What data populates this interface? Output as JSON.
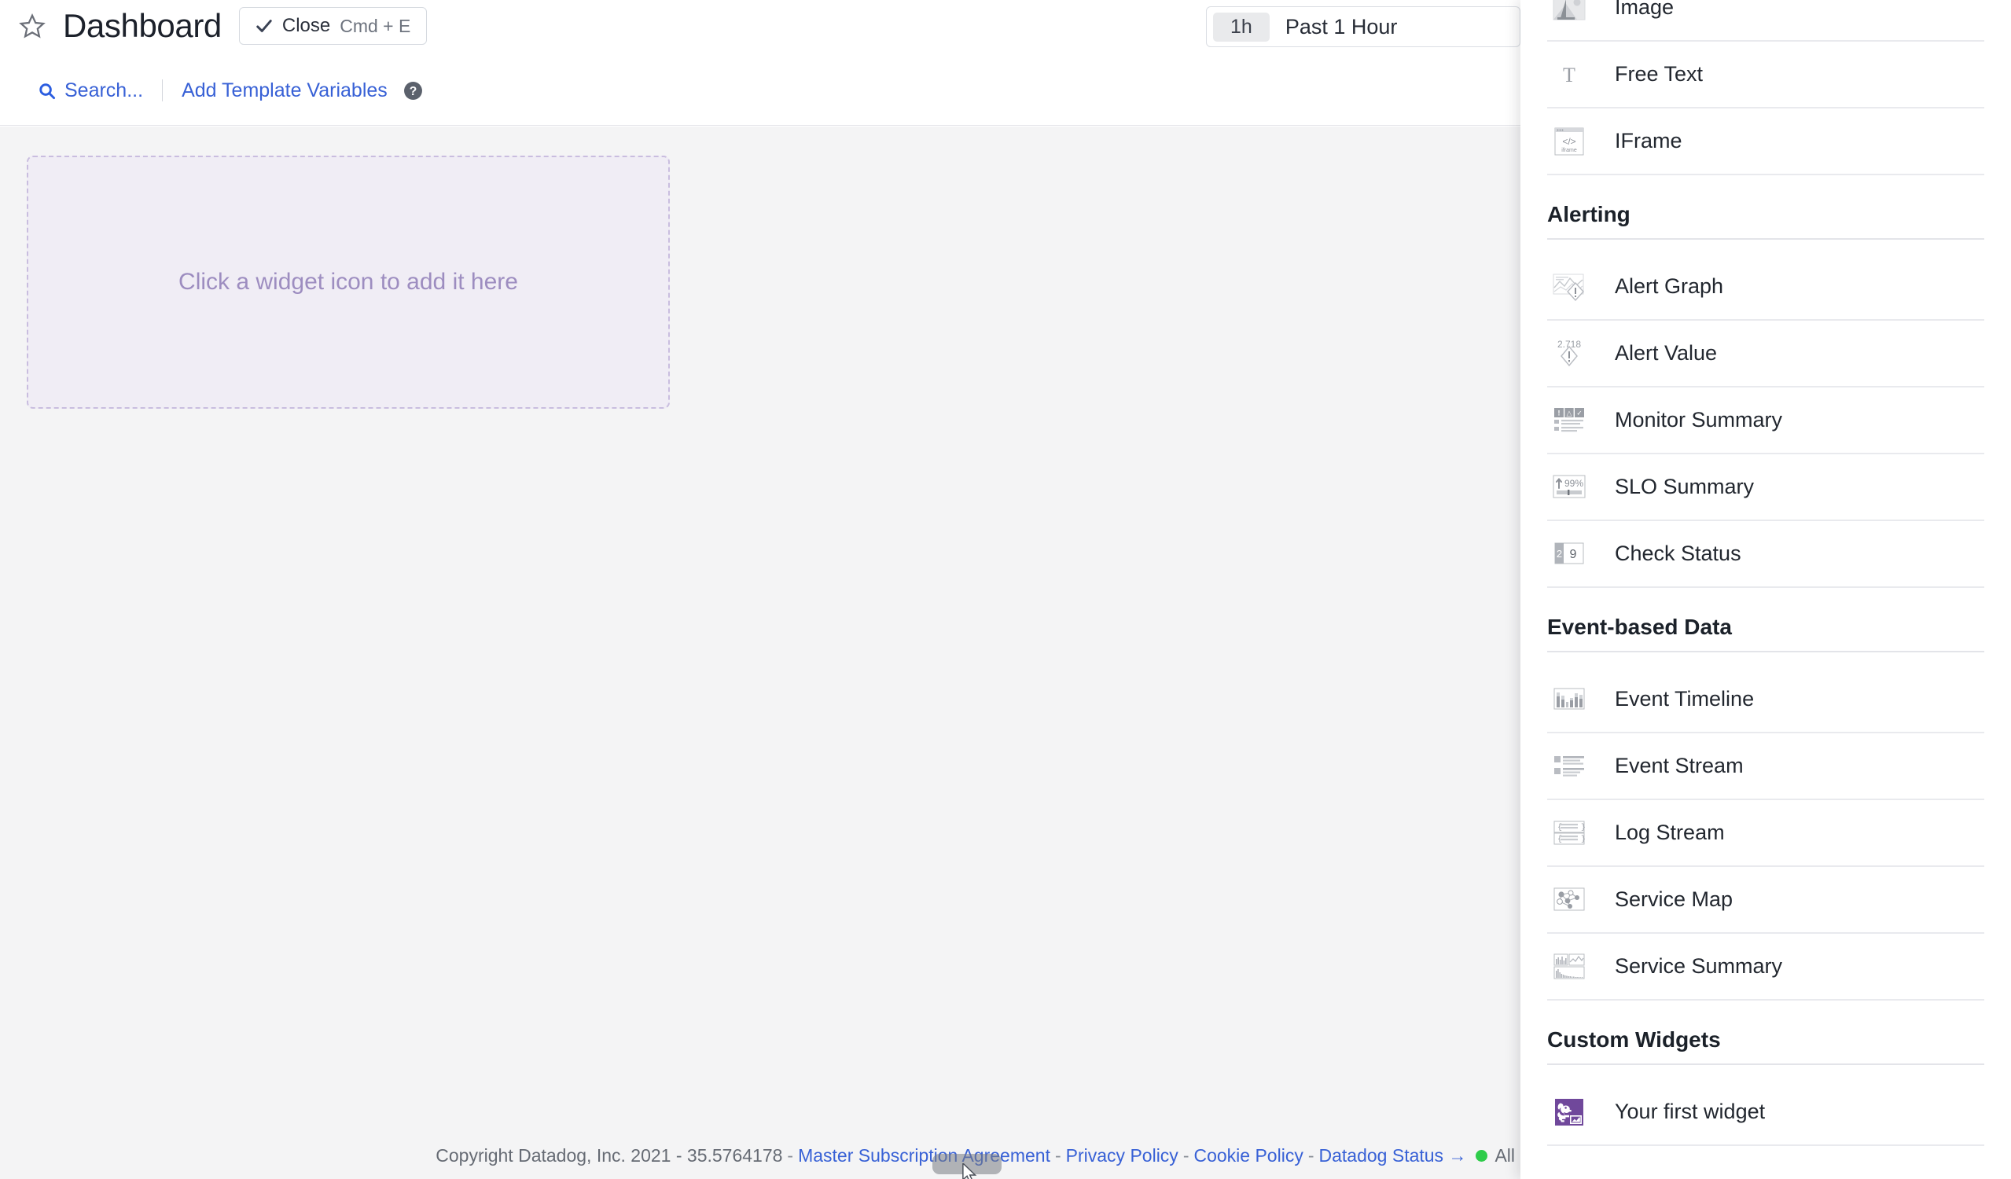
{
  "header": {
    "star_icon": "star-icon",
    "title": "Dashboard",
    "close_button": {
      "icon": "check-icon",
      "label": "Close",
      "shortcut": "Cmd + E"
    },
    "search_link": {
      "icon": "search-icon",
      "label": "Search..."
    },
    "template_variables_link": "Add Template Variables",
    "help_icon": "help-circle-icon"
  },
  "time_picker": {
    "chip": "1h",
    "label": "Past 1 Hour"
  },
  "canvas": {
    "drop_zone_text": "Click a widget icon to add it here"
  },
  "footer": {
    "copyright": "Copyright Datadog, Inc. 2021 - 35.5764178",
    "links": [
      "Master Subscription Agreement",
      "Privacy Policy",
      "Cookie Policy",
      "Datadog Status →"
    ],
    "status_text": "All Systen",
    "status_color": "#2ecc4a"
  },
  "side_panel": {
    "groups": [
      {
        "heading": null,
        "items": [
          {
            "label": "Image",
            "icon": "image-picture-icon"
          },
          {
            "label": "Free Text",
            "icon": "free-text-icon"
          },
          {
            "label": "IFrame",
            "icon": "iframe-icon"
          }
        ]
      },
      {
        "heading": "Alerting",
        "items": [
          {
            "label": "Alert Graph",
            "icon": "alert-graph-icon"
          },
          {
            "label": "Alert Value",
            "icon": "alert-value-icon",
            "value": "2.718"
          },
          {
            "label": "Monitor Summary",
            "icon": "monitor-summary-icon"
          },
          {
            "label": "SLO Summary",
            "icon": "slo-summary-icon",
            "value": "99%"
          },
          {
            "label": "Check Status",
            "icon": "check-status-icon",
            "value_left": "2",
            "value_right": "9"
          }
        ]
      },
      {
        "heading": "Event-based Data",
        "items": [
          {
            "label": "Event Timeline",
            "icon": "event-timeline-icon"
          },
          {
            "label": "Event Stream",
            "icon": "event-stream-icon"
          },
          {
            "label": "Log Stream",
            "icon": "log-stream-icon"
          },
          {
            "label": "Service Map",
            "icon": "service-map-icon"
          },
          {
            "label": "Service Summary",
            "icon": "service-summary-icon"
          }
        ]
      },
      {
        "heading": "Custom Widgets",
        "items": [
          {
            "label": "Your first widget",
            "icon": "datadog-dog-icon"
          }
        ]
      }
    ]
  },
  "colors": {
    "link_blue": "#3861d6",
    "canvas_bg": "#f4f4f5",
    "dropzone_border": "#c9bddf",
    "dropzone_text": "#9d8dc0",
    "brand_purple": "#70489b"
  }
}
